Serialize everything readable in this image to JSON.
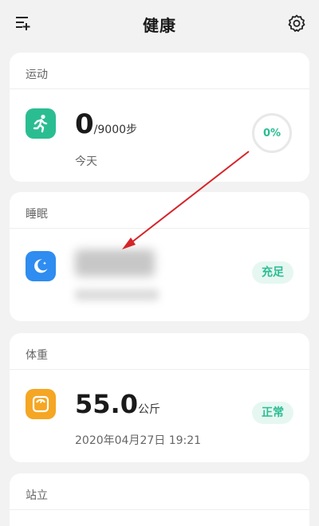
{
  "header": {
    "title": "健康",
    "left_icon": "list-add-icon",
    "right_icon": "gear-icon"
  },
  "exercise": {
    "title": "运动",
    "icon": "running-person-icon",
    "steps_value": "0",
    "steps_goal": "/9000步",
    "subtitle": "今天",
    "percent": "0%"
  },
  "sleep": {
    "title": "睡眠",
    "icon": "moon-icon",
    "status": "充足"
  },
  "weight": {
    "title": "体重",
    "icon": "scale-icon",
    "value": "55.0",
    "unit": "公斤",
    "timestamp": "2020年04月27日 19:21",
    "status": "正常"
  },
  "standing": {
    "title": "站立"
  },
  "colors": {
    "accent_green": "#2bbd92",
    "sleep_blue": "#2f8cf0",
    "weight_orange": "#f5a623",
    "annotation_red": "#d6232a"
  }
}
